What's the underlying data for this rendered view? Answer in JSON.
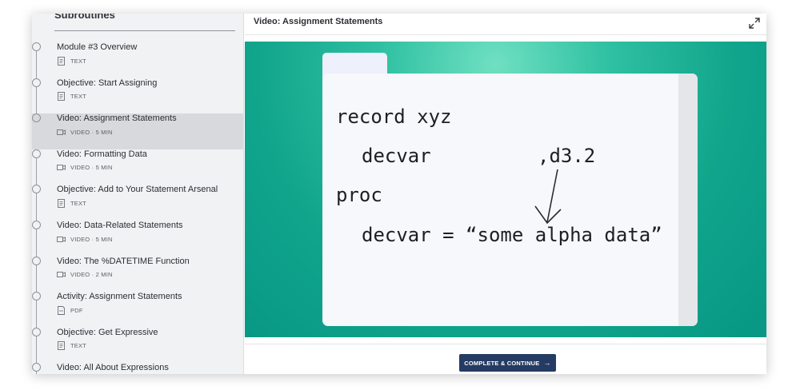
{
  "sidebar": {
    "section_title": "Subroutines",
    "items": [
      {
        "title": "Module #3 Overview",
        "meta": "TEXT",
        "icon": "text-doc-icon"
      },
      {
        "title": "Objective: Start Assigning",
        "meta": "TEXT",
        "icon": "text-doc-icon"
      },
      {
        "title": "Video: Assignment Statements",
        "meta": "VIDEO · 5 MIN",
        "icon": "video-camera-icon",
        "active": true
      },
      {
        "title": "Video: Formatting Data",
        "meta": "VIDEO · 5 MIN",
        "icon": "video-camera-icon"
      },
      {
        "title": "Objective: Add to Your Statement Arsenal",
        "meta": "TEXT",
        "icon": "text-doc-icon"
      },
      {
        "title": "Video: Data-Related Statements",
        "meta": "VIDEO · 5 MIN",
        "icon": "video-camera-icon"
      },
      {
        "title": "Video: The %DATETIME Function",
        "meta": "VIDEO · 2 MIN",
        "icon": "video-camera-icon"
      },
      {
        "title": "Activity: Assignment Statements",
        "meta": "PDF",
        "icon": "pdf-doc-icon"
      },
      {
        "title": "Objective: Get Expressive",
        "meta": "TEXT",
        "icon": "text-doc-icon"
      },
      {
        "title": "Video: All About Expressions",
        "meta": "",
        "icon": ""
      }
    ]
  },
  "main": {
    "header_title": "Video: Assignment Statements",
    "video": {
      "code_lines": [
        "record xyz",
        "decvar",
        ",d3.2",
        "proc",
        "decvar = “some alpha data”"
      ]
    },
    "complete_button": "COMPLETE & CONTINUE",
    "complete_arrow": "→"
  },
  "colors": {
    "sidebar_bg": "#f1f2f3",
    "active_item_bg": "#d8d9dc",
    "video_teal": "#11a58c",
    "button_navy": "#253b63"
  }
}
